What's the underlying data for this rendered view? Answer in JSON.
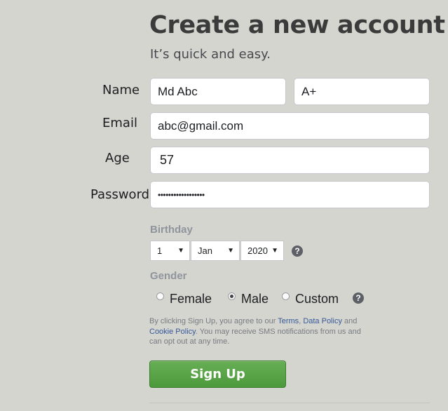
{
  "header": {
    "title": "Create a new account",
    "subtitle": "It’s quick and easy."
  },
  "form": {
    "name_label": "Name",
    "first_name_value": "Md Abc",
    "last_name_value": "A+",
    "email_label": "Email",
    "email_value": "abc@gmail.com",
    "age_label": "Age",
    "age_value": "57",
    "password_label": "Password",
    "password_value": "••••••••••••••••••"
  },
  "birthday": {
    "label": "Birthday",
    "day": "1",
    "month": "Jan",
    "year": "2020",
    "help_glyph": "?"
  },
  "gender": {
    "label": "Gender",
    "options": [
      {
        "label": "Female",
        "checked": false
      },
      {
        "label": "Male",
        "checked": true
      },
      {
        "label": "Custom",
        "checked": false
      }
    ],
    "help_glyph": "?"
  },
  "terms": {
    "part1": "By clicking Sign Up, you agree to our ",
    "terms_link": "Terms",
    "sep": ", ",
    "data_policy_link": "Data Policy",
    "part2": " and ",
    "cookie_policy_link": "Cookie Policy",
    "part3": ". You may receive SMS notifications from us and can opt out at any time."
  },
  "signup": {
    "label": "Sign Up",
    "color": "#5aa447"
  },
  "icons": {
    "dropdown": "caret-down-icon",
    "help": "help-icon"
  }
}
